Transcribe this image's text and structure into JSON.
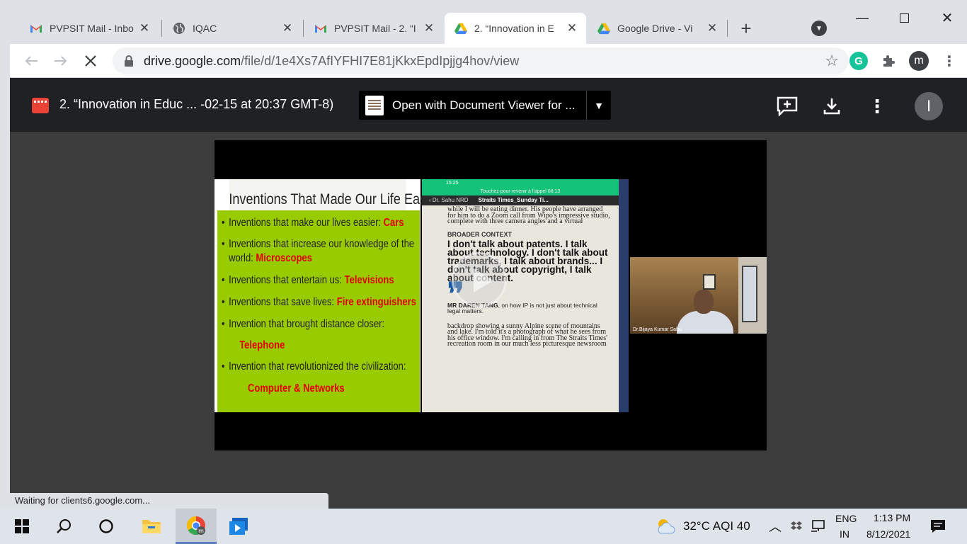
{
  "tabs": [
    {
      "title": "PVPSIT Mail - Inbo",
      "icon": "gmail-icon",
      "active": false
    },
    {
      "title": "IQAC",
      "icon": "globe-icon",
      "active": false
    },
    {
      "title": "PVPSIT Mail - 2. “I",
      "icon": "gmail-icon",
      "active": false
    },
    {
      "title": "2. “Innovation in E",
      "icon": "google-drive-icon",
      "active": true
    },
    {
      "title": "Google Drive - Vi",
      "icon": "google-drive-icon",
      "active": false
    }
  ],
  "toolbar": {
    "url_host": "drive.google.com",
    "url_path": "/file/d/1e4Xs7AfIYFHI7E81jKkxEpdIpjjg4hov/view",
    "profile_initial": "m",
    "grammarly_letter": "G"
  },
  "viewer": {
    "file_title": "2. “Innovation in Educ ... -02-15 at 20:37 GMT-8)",
    "open_with_label": "Open with Document Viewer for ...",
    "account_initial": "I"
  },
  "video": {
    "slide": {
      "title": "Inventions That Made Our Life Easier",
      "items": [
        {
          "text": "Inventions that make our lives easier: ",
          "highlight": "Cars"
        },
        {
          "text": "Inventions that increase our knowledge of the world: ",
          "highlight": "Microscopes"
        },
        {
          "text": "Inventions that entertain us: ",
          "highlight": "Televisions"
        },
        {
          "text": "Inventions that save lives: ",
          "highlight": "Fire extinguishers"
        },
        {
          "text": "Invention that brought distance closer:",
          "highlight": "Telephone"
        },
        {
          "text": "Invention that revolutionized the civilization:",
          "highlight": "Computer & Networks"
        }
      ]
    },
    "phone": {
      "status_time": "15:25",
      "banner": "Touchez pour revenir à l'appel 08:13",
      "chat_name": "Dr. Sahu NRD",
      "chat_title": "Straits Times_Sunday Ti...",
      "para1": "while I will be eating dinner. His people have arranged for him to do a Zoom call from Wipo's impressive studio, complete with three camera angles and a virtual",
      "caption": "BROADER CONTEXT",
      "quote": "I don't talk about patents. I talk about technology. I don't talk about trademarks, I talk about brands... I don't talk about copyright, I talk about content.",
      "quote_mark": "❞",
      "attr_name": "MR DAREN TANG",
      "attr_rest": ", on how IP is not just about technical legal matters.",
      "para2": "backdrop showing a sunny Alpine scene of mountains and lake. I'm told it's a photograph of what he sees from his office window. I'm calling in from The Straits Times' recreation room in our much less picturesque newsroom"
    },
    "cam_name": "Dr.Bijaya Kumar Sahu"
  },
  "status_bubble": "Waiting for clients6.google.com...",
  "taskbar": {
    "weather": "32°C  AQI 40",
    "lang_top": "ENG",
    "lang_bottom": "IN",
    "time": "1:13 PM",
    "date": "8/12/2021"
  }
}
